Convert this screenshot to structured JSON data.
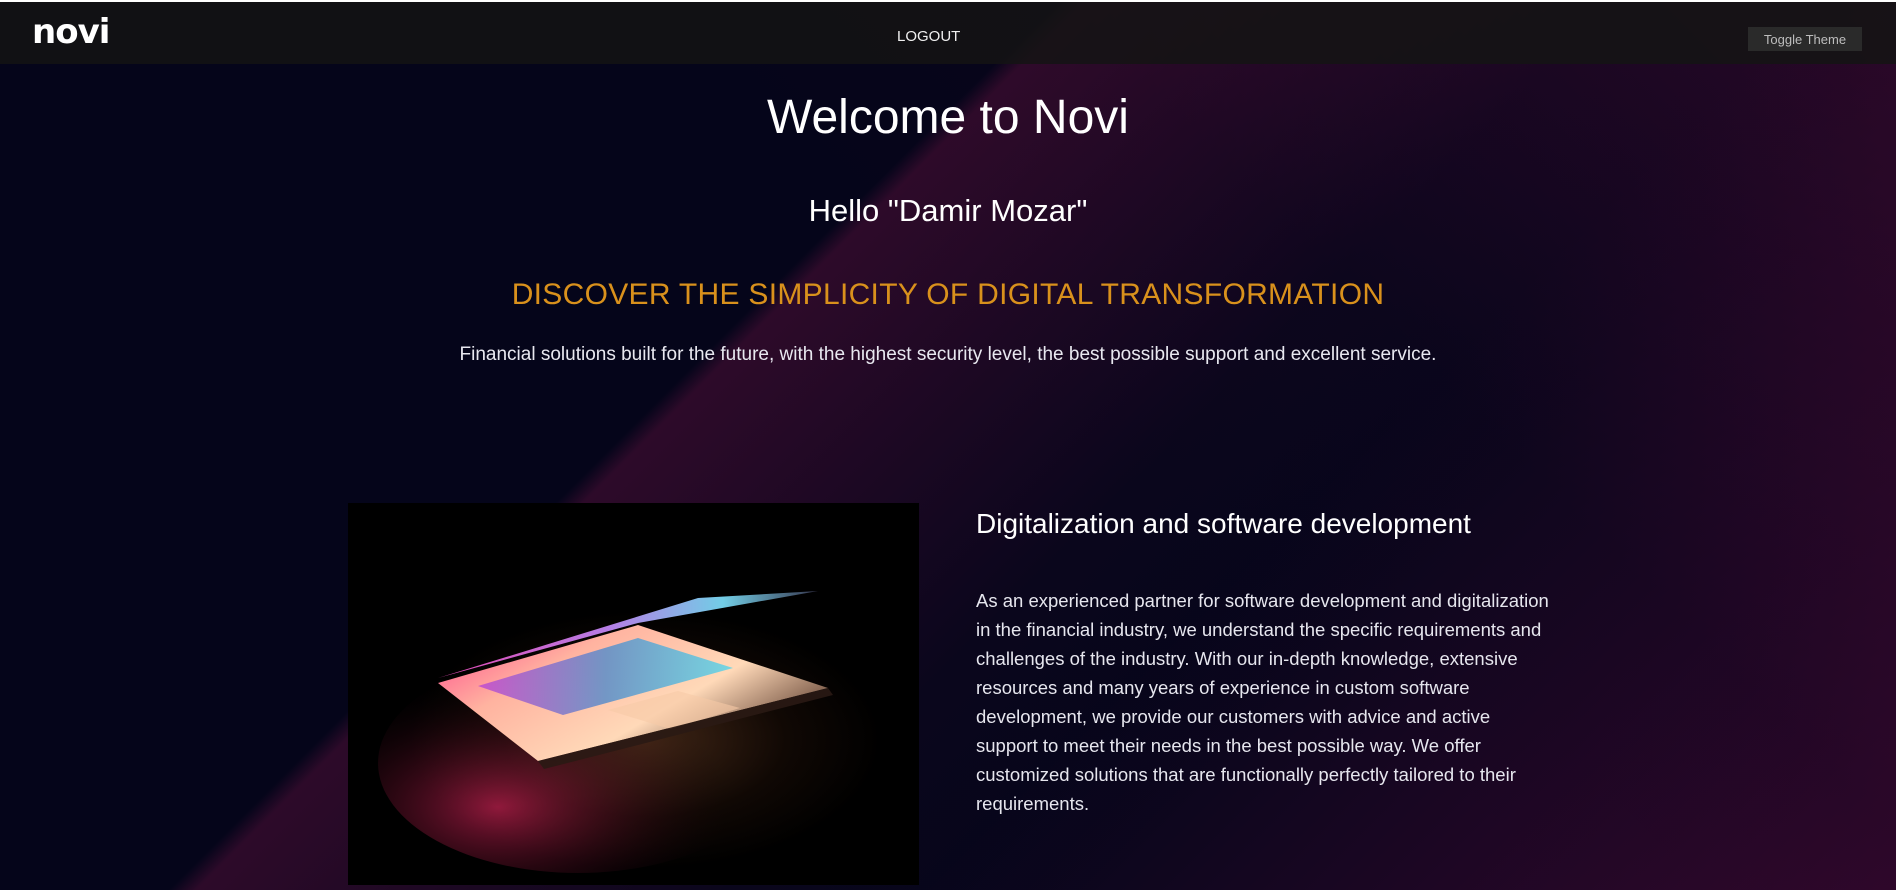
{
  "header": {
    "logo": "novi",
    "logout_label": "LOGOUT",
    "toggle_label": "Toggle Theme"
  },
  "hero": {
    "title": "Welcome to Novi",
    "greeting": "Hello \"Damir Mozar\"",
    "headline": "DISCOVER THE SIMPLICITY OF DIGITAL TRANSFORMATION",
    "tagline": "Financial solutions built for the future, with the highest security level, the best possible support and excellent service."
  },
  "feature": {
    "image_alt": "laptop",
    "title": "Digitalization and software development",
    "body": "As an experienced partner for software development and digitalization in the financial industry, we understand the specific requirements and challenges of the industry. With our in-depth knowledge, extensive resources and many years of experience in custom software development, we provide our customers with advice and active support to meet their needs in the best possible way. We offer customized solutions that are functionally perfectly tailored to their requirements."
  },
  "colors": {
    "background": "#05051a",
    "accent_headline": "#d9911c",
    "topbar": "#141414"
  }
}
